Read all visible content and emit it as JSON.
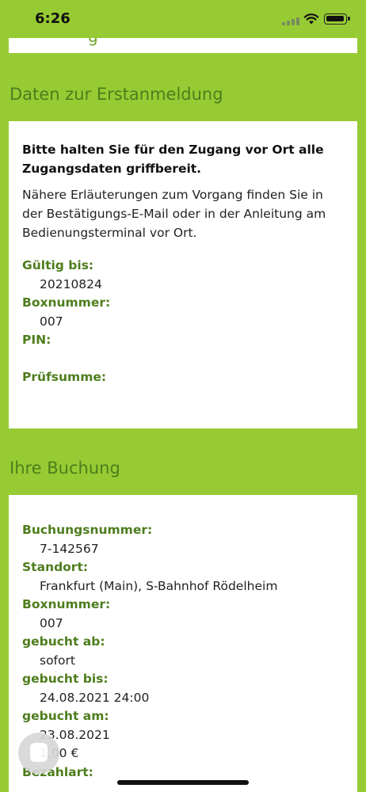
{
  "status_bar": {
    "time": "6:26"
  },
  "top_card": {
    "partial_text": "g"
  },
  "erstanmeldung": {
    "title": "Daten zur Erstanmeldung",
    "intro_bold": "Bitte halten Sie für den Zugang vor Ort alle Zugangsdaten griffbereit.",
    "intro": "Nähere Erläuterungen zum Vorgang finden Sie in der Bestätigungs-E-Mail oder in der Anleitung am Bedienungsterminal vor Ort.",
    "fields": [
      {
        "label": "Gültig bis:",
        "value": "20210824"
      },
      {
        "label": "Boxnummer:",
        "value": "007"
      },
      {
        "label": "PIN:",
        "value": ""
      },
      {
        "label": "Prüfsumme:",
        "value": ""
      }
    ]
  },
  "buchung": {
    "title": "Ihre Buchung",
    "fields": [
      {
        "label": "Buchungsnummer:",
        "value": "7-142567"
      },
      {
        "label": "Standort:",
        "value": "Frankfurt (Main), S-Bahnhof Rödelheim"
      },
      {
        "label": "Boxnummer:",
        "value": "007"
      },
      {
        "label": "gebucht ab:",
        "value": "sofort"
      },
      {
        "label": "gebucht bis:",
        "value": "24.08.2021 24:00"
      },
      {
        "label": "gebucht am:",
        "value": "23.08.2021"
      },
      {
        "label": "",
        "value": "1,00 €"
      },
      {
        "label": "Bezahlart:",
        "value": ""
      }
    ]
  },
  "icons": {
    "chat": "chat-bubble-icon",
    "wifi": "wifi-icon",
    "battery": "battery-icon",
    "signal": "signal-icon"
  }
}
